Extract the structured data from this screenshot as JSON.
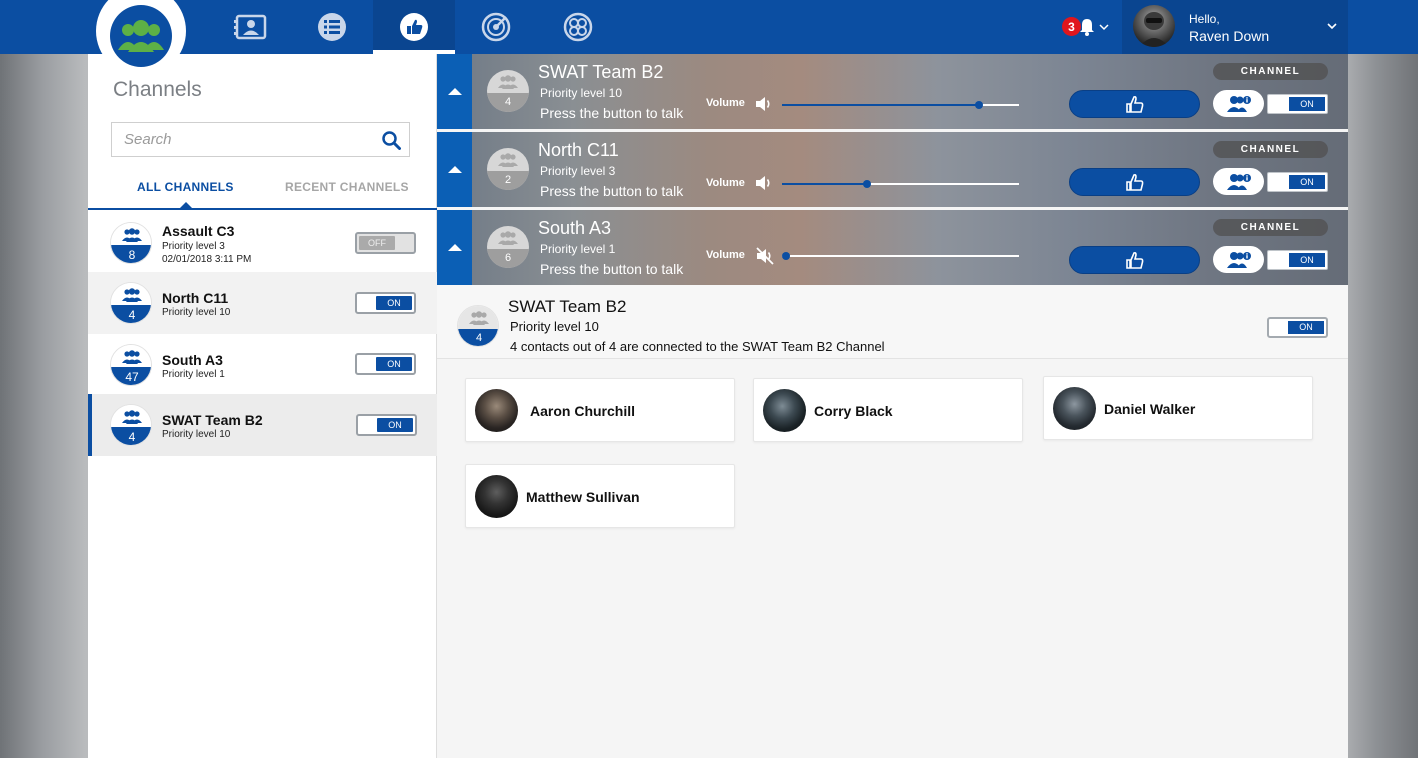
{
  "user": {
    "greeting": "Hello,",
    "name": "Raven Down"
  },
  "notifications": {
    "count": "3"
  },
  "nav": [
    {
      "icon": "contacts-card-icon"
    },
    {
      "icon": "list-icon"
    },
    {
      "icon": "push-to-talk-icon",
      "active": true
    },
    {
      "icon": "radar-icon"
    },
    {
      "icon": "groups-circle-icon"
    }
  ],
  "sidebar": {
    "title": "Channels",
    "search_placeholder": "Search",
    "tabs": {
      "all": "ALL CHANNELS",
      "recent": "RECENT CHANNELS"
    },
    "channels": [
      {
        "name": "Assault C3",
        "priority": "Priority level 3",
        "date": "02/01/2018 3:11 PM",
        "count": "8",
        "toggle": "OFF"
      },
      {
        "name": "North C11",
        "priority": "Priority level 10",
        "count": "4",
        "toggle": "ON"
      },
      {
        "name": "South A3",
        "priority": "Priority level 1",
        "count": "47",
        "toggle": "ON"
      },
      {
        "name": "SWAT Team B2",
        "priority": "Priority level 10",
        "count": "4",
        "toggle": "ON"
      }
    ]
  },
  "active_channels": [
    {
      "name": "SWAT Team B2",
      "priority": "Priority level 10",
      "ptt": "Press the button to talk",
      "count": "4",
      "volume_label": "Volume",
      "volume": 0.83,
      "muted": false,
      "pill": "CHANNEL",
      "toggle": "ON"
    },
    {
      "name": "North C11",
      "priority": "Priority level 3",
      "ptt": "Press the button to talk",
      "count": "2",
      "volume_label": "Volume",
      "volume": 0.36,
      "muted": false,
      "pill": "CHANNEL",
      "toggle": "ON"
    },
    {
      "name": "South A3",
      "priority": "Priority level 1",
      "ptt": "Press the button to talk",
      "count": "6",
      "volume_label": "Volume",
      "volume": 0.0,
      "muted": true,
      "pill": "CHANNEL",
      "toggle": "ON"
    }
  ],
  "detail": {
    "name": "SWAT Team B2",
    "priority": "Priority level 10",
    "count": "4",
    "connected_text": "4 contacts out of 4 are connected to the SWAT Team B2 Channel",
    "toggle": "ON"
  },
  "contacts": [
    {
      "name": "Aaron Churchill"
    },
    {
      "name": "Corry Black"
    },
    {
      "name": "Daniel Walker"
    },
    {
      "name": "Matthew Sullivan"
    }
  ],
  "colors": {
    "primary": "#0b4ea2",
    "accent_dark": "#0a4590",
    "badge": "#e0161d"
  }
}
